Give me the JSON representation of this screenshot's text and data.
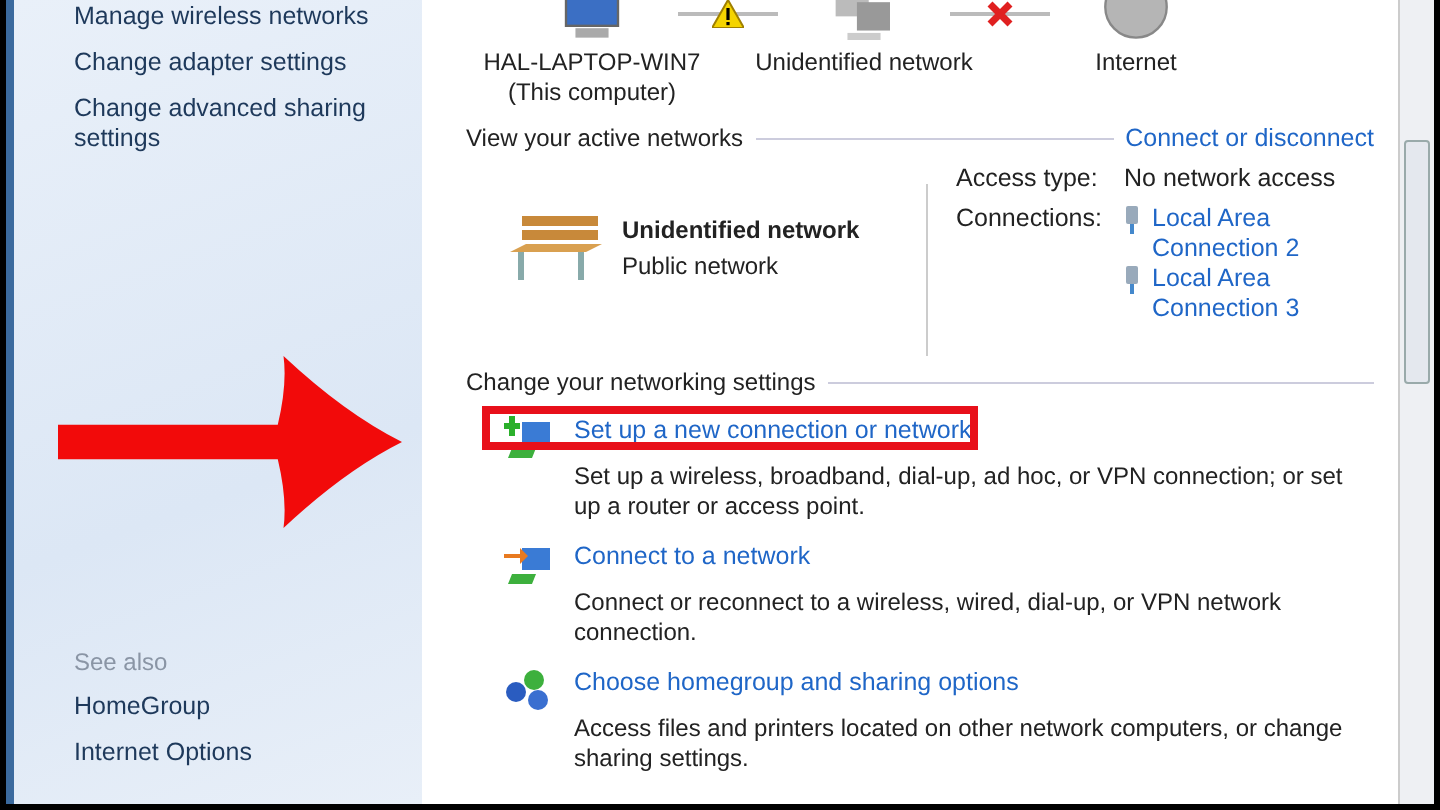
{
  "sidebar": {
    "links": [
      "Manage wireless networks",
      "Change adapter settings",
      "Change advanced sharing settings"
    ],
    "see_also": {
      "heading": "See also",
      "links": [
        "HomeGroup",
        "Internet Options"
      ]
    }
  },
  "network_map": {
    "nodes": [
      {
        "label": "HAL-LAPTOP-WIN7",
        "sublabel": "(This computer)",
        "kind": "computer"
      },
      {
        "label": "Unidentified network",
        "kind": "network"
      },
      {
        "label": "Internet",
        "kind": "globe"
      }
    ],
    "links": [
      {
        "kind": "warning"
      },
      {
        "kind": "broken"
      }
    ]
  },
  "active_networks": {
    "heading": "View your active networks",
    "action": "Connect or disconnect",
    "network": {
      "name": "Unidentified network",
      "category": "Public network"
    },
    "access_type_label": "Access type:",
    "access_type": "No network access",
    "connections_label": "Connections:",
    "connections": [
      "Local Area Connection 2",
      "Local Area Connection 3"
    ]
  },
  "settings": {
    "heading": "Change your networking settings",
    "tasks": [
      {
        "kind": "new",
        "title": "Set up a new connection or network",
        "description": "Set up a wireless, broadband, dial-up, ad hoc, or VPN connection; or set up a router or access point.",
        "highlighted": true
      },
      {
        "kind": "connect",
        "title": "Connect to a network",
        "description": "Connect or reconnect to a wireless, wired, dial-up, or VPN network connection.",
        "highlighted": false
      },
      {
        "kind": "homegroup",
        "title": "Choose homegroup and sharing options",
        "description": "Access files and printers located on other network computers, or change sharing settings.",
        "highlighted": false
      }
    ]
  }
}
